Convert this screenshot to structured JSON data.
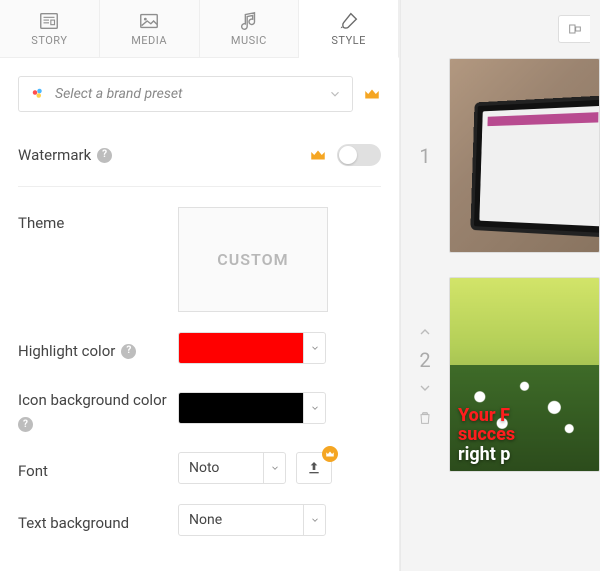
{
  "tabs": {
    "story": "STORY",
    "media": "MEDIA",
    "music": "MUSIC",
    "style": "STYLE"
  },
  "brand": {
    "placeholder": "Select a brand preset"
  },
  "labels": {
    "watermark": "Watermark",
    "theme": "Theme",
    "highlight_color": "Highlight color",
    "icon_bg_color": "Icon background color",
    "font": "Font",
    "text_background": "Text background"
  },
  "theme_value": "CUSTOM",
  "colors": {
    "highlight": "#ff0000",
    "icon_bg": "#000000"
  },
  "font_value": "Noto",
  "text_bg_value": "None",
  "slides": {
    "s1_index": "1",
    "s2_index": "2",
    "s2_line1": "Your F",
    "s2_line1b": "succes",
    "s2_line2": "right p"
  }
}
